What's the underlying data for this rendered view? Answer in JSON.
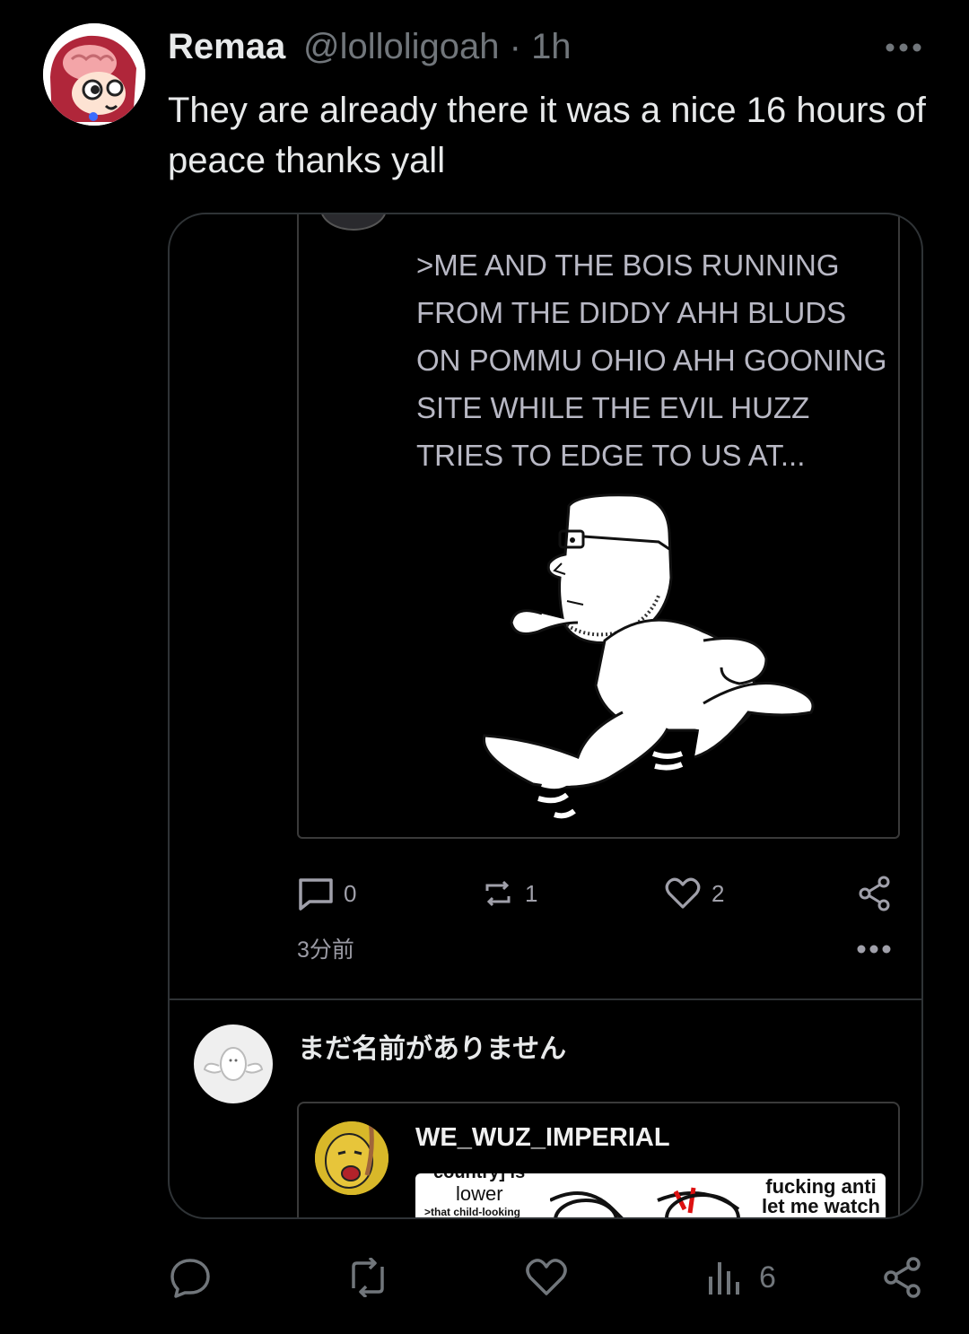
{
  "tweet": {
    "author_name": "Remaa",
    "handle_time": "@lolloligoah · 1h",
    "text": "They are already there it was a nice 16 hours of peace thanks yall",
    "views": "6"
  },
  "embedded_post": {
    "text": ">ME AND THE BOIS RUNNING FROM THE DIDDY AHH BLUDS ON POMMU OHIO AHH GOONING SITE WHILE THE EVIL HUZZ TRIES TO EDGE TO US AT...",
    "reply_count": "0",
    "repost_count": "1",
    "like_count": "2",
    "timestamp": "3分前"
  },
  "next_reply": {
    "author_name": "まだ名前がありません",
    "quoted_author": "WE_WUZ_IMPERIAL",
    "meme_text_left_top": "country] is",
    "meme_text_left": "lower",
    "meme_text_small": ">that child-looking",
    "meme_text_right_1": "fucking anti",
    "meme_text_right_2": "let me watch"
  },
  "colors": {
    "background": "#000000",
    "text_primary": "#e7e9ea",
    "text_secondary": "#71767b",
    "border": "#2f3336"
  }
}
